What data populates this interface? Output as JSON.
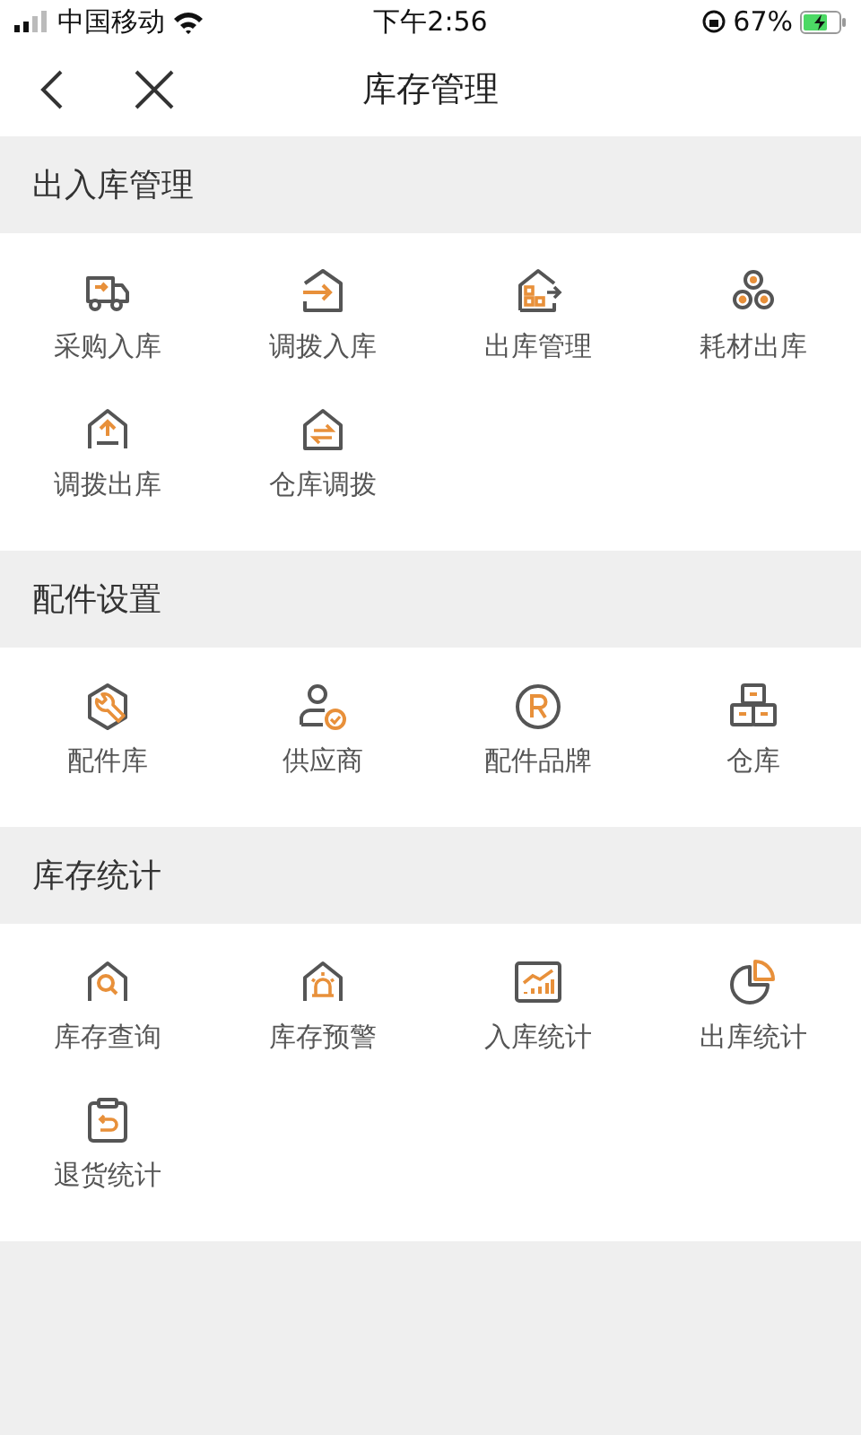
{
  "status_bar": {
    "carrier": "中国移动",
    "time": "下午2:56",
    "battery": "67%"
  },
  "nav": {
    "title": "库存管理"
  },
  "sections": [
    {
      "title": "出入库管理",
      "items": [
        {
          "label": "采购入库"
        },
        {
          "label": "调拨入库"
        },
        {
          "label": "出库管理"
        },
        {
          "label": "耗材出库"
        },
        {
          "label": "调拨出库"
        },
        {
          "label": "仓库调拨"
        }
      ]
    },
    {
      "title": "配件设置",
      "items": [
        {
          "label": "配件库"
        },
        {
          "label": "供应商"
        },
        {
          "label": "配件品牌"
        },
        {
          "label": "仓库"
        }
      ]
    },
    {
      "title": "库存统计",
      "items": [
        {
          "label": "库存查询"
        },
        {
          "label": "库存预警"
        },
        {
          "label": "入库统计"
        },
        {
          "label": "出库统计"
        },
        {
          "label": "退货统计"
        }
      ]
    }
  ]
}
